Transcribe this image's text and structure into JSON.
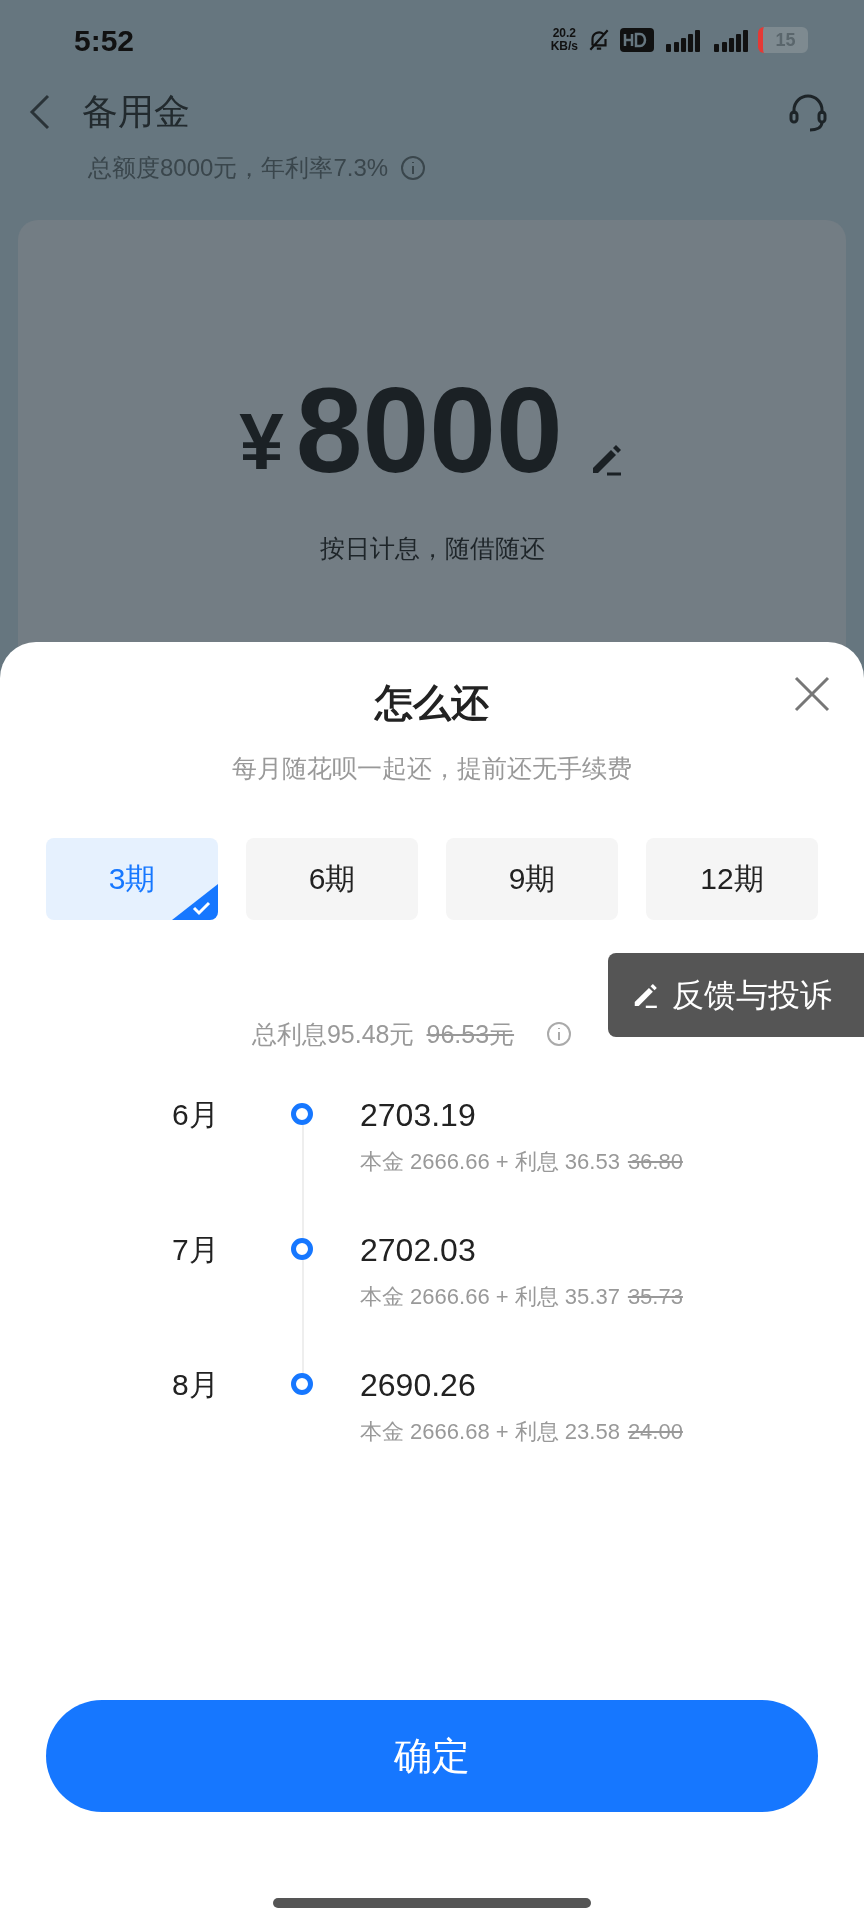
{
  "status_bar": {
    "time": "5:52",
    "speed_value": "20.2",
    "speed_unit": "KB/s",
    "battery": "15"
  },
  "header": {
    "title": "备用金",
    "subtitle": "总额度8000元，年利率7.3%"
  },
  "amount_card": {
    "currency": "¥",
    "amount": "8000",
    "note": "按日计息，随借随还"
  },
  "sheet": {
    "title": "怎么还",
    "subtitle": "每月随花呗一起还，提前还无手续费",
    "terms": [
      {
        "label": "3期",
        "selected": true
      },
      {
        "label": "6期",
        "selected": false
      },
      {
        "label": "9期",
        "selected": false
      },
      {
        "label": "12期",
        "selected": false
      }
    ],
    "feedback_button": "反馈与投诉",
    "total_interest": {
      "label": "总利息95.48元",
      "original": "96.53元"
    },
    "schedule": [
      {
        "month": "6月",
        "amount": "2703.19",
        "detail": "本金 2666.66 + 利息 36.53",
        "original": "36.80"
      },
      {
        "month": "7月",
        "amount": "2702.03",
        "detail": "本金 2666.66 + 利息 35.37",
        "original": "35.73"
      },
      {
        "month": "8月",
        "amount": "2690.26",
        "detail": "本金 2666.68 + 利息 23.58",
        "original": "24.00"
      }
    ],
    "confirm": "确定"
  }
}
